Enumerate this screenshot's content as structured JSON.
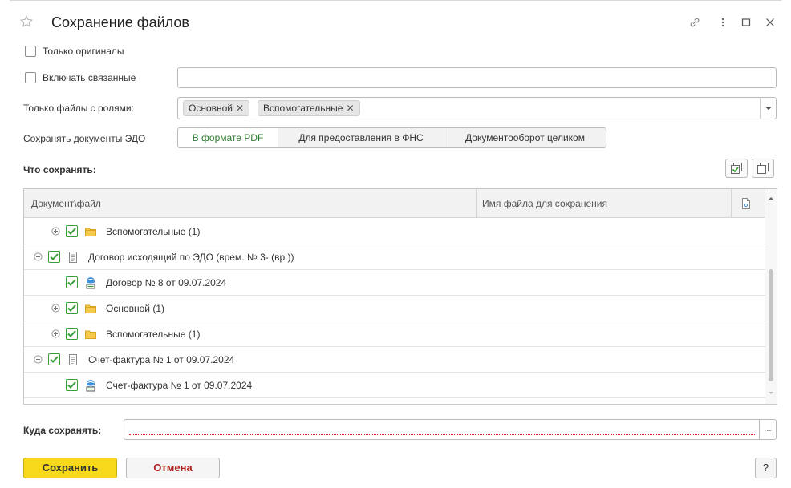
{
  "window": {
    "title": "Сохранение файлов",
    "icons": [
      "star-icon",
      "link-icon",
      "more-icon",
      "maximize-icon",
      "close-icon"
    ]
  },
  "options": {
    "originals_only_label": "Только оригиналы",
    "include_related_label": "Включать связанные",
    "include_related_value": "",
    "roles_label": "Только файлы с ролями:",
    "roles_tags": [
      "Основной",
      "Вспомогательные"
    ],
    "edo_label": "Сохранять документы ЭДО",
    "edo_options": [
      "В формате PDF",
      "Для предоставления в ФНС",
      "Документооборот целиком"
    ],
    "edo_selected": "В формате PDF"
  },
  "what_to_save": {
    "label": "Что сохранять:",
    "columns": [
      "Документ\\файл",
      "Имя файла для сохранения"
    ],
    "rows": [
      {
        "level": 1,
        "type": "folder",
        "expandable": true,
        "checked": true,
        "label": "Вспомогательные (1)"
      },
      {
        "level": 0,
        "type": "document",
        "expandable": true,
        "checked": true,
        "label": "Договор исходящий по ЭДО (врем. № 3- (вр.))"
      },
      {
        "level": 1,
        "type": "edo-file",
        "expandable": false,
        "checked": true,
        "label": "Договор № 8 от 09.07.2024"
      },
      {
        "level": 1,
        "type": "folder",
        "expandable": true,
        "checked": true,
        "label": "Основной (1)"
      },
      {
        "level": 1,
        "type": "folder",
        "expandable": true,
        "checked": true,
        "label": "Вспомогательные (1)"
      },
      {
        "level": 0,
        "type": "document",
        "expandable": true,
        "checked": true,
        "label": "Счет-фактура № 1 от 09.07.2024"
      },
      {
        "level": 1,
        "type": "edo-file",
        "expandable": false,
        "checked": true,
        "label": "Счет-фактура № 1 от 09.07.2024"
      }
    ]
  },
  "destination": {
    "label": "Куда сохранять:",
    "value": "",
    "browse_label": "..."
  },
  "footer": {
    "save_label": "Сохранить",
    "cancel_label": "Отмена",
    "help_label": "?"
  },
  "colors": {
    "accent_green": "#2e7d32",
    "check_green": "#3a9d3a",
    "save_yellow": "#f8d81a",
    "cancel_red": "#b22222",
    "required_red": "#e02020"
  }
}
